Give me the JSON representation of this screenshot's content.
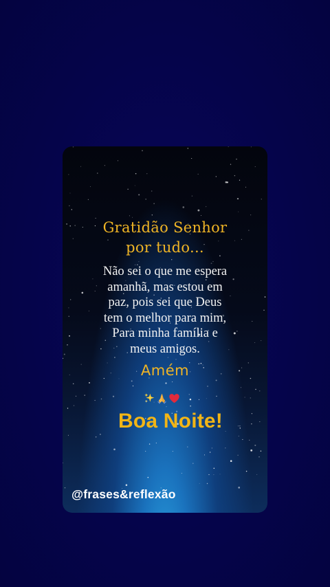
{
  "card": {
    "title_lines": [
      "Gratidão Senhor",
      "por tudo..."
    ],
    "body_lines": [
      "Não sei o que me espera",
      "amanhã, mas estou em",
      "paz, pois sei que Deus",
      "tem o melhor para mim,",
      "Para minha família e",
      "meus amigos."
    ],
    "amen": "Amém",
    "emojis": [
      "sparkles-icon",
      "praying-hands-icon",
      "red-heart-icon"
    ],
    "greeting": "Boa Noite!",
    "handle": "@frases&reflexão"
  },
  "colors": {
    "page_background": "#05044a",
    "title_gold": "#efb425",
    "greeting_gold": "#f2b516",
    "body_text": "#f2f2f2",
    "card_glow_blue": "#2aa2e0"
  }
}
